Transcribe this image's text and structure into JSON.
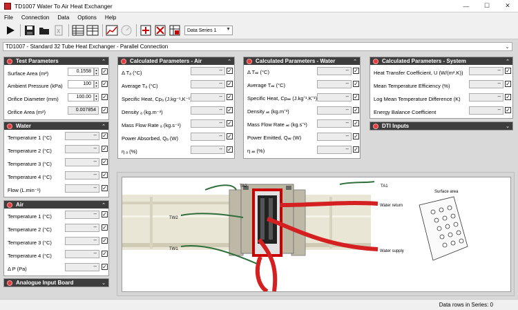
{
  "window": {
    "title": "TD1007 Water To Air Heat Exchanger"
  },
  "menu": [
    "File",
    "Connection",
    "Data",
    "Options",
    "Help"
  ],
  "toolbar": {
    "data_series": "Data Series 1"
  },
  "apparatus": {
    "selected": "TD1007 - Standard 32 Tube Heat Exchanger - Parallel Connection"
  },
  "test_params": {
    "title": "Test Parameters",
    "rows": [
      {
        "label": "Surface Area  (m²)",
        "value": "0.1558"
      },
      {
        "label": "Ambient Pressure  (kPa)",
        "value": "100"
      },
      {
        "label": "Orifice Diameter  (mm)",
        "value": "100.00"
      },
      {
        "label": "Orifice Area  (m²)",
        "value": "0.007854"
      }
    ]
  },
  "water": {
    "title": "Water",
    "rows": [
      {
        "label": "Temperature 1  (°C)",
        "value": "--"
      },
      {
        "label": "Temperature 2  (°C)",
        "value": "--"
      },
      {
        "label": "Temperature 3  (°C)",
        "value": "--"
      },
      {
        "label": "Temperature 4  (°C)",
        "value": "--"
      },
      {
        "label": "Flow  (L.min⁻¹)",
        "value": "--"
      }
    ]
  },
  "air": {
    "title": "Air",
    "rows": [
      {
        "label": "Temperature 1  (°C)",
        "value": "--"
      },
      {
        "label": "Temperature 2  (°C)",
        "value": "--"
      },
      {
        "label": "Temperature 3  (°C)",
        "value": "--"
      },
      {
        "label": "Temperature 4  (°C)",
        "value": "--"
      },
      {
        "label": "Δ P  (Pa)",
        "value": "--"
      }
    ]
  },
  "analogue": {
    "title": "Analogue Input Board"
  },
  "calc_air": {
    "title": "Calculated Parameters - Air",
    "rows": [
      {
        "label": "Δ Tₐ  (°C)",
        "value": "--"
      },
      {
        "label": "Average Tₐ  (°C)",
        "value": "--"
      },
      {
        "label": "Specific Heat, Cpₐ  (J.kg⁻¹.K⁻¹)",
        "value": "--"
      },
      {
        "label": "Density ₐ  (kg.m⁻³)",
        "value": "--"
      },
      {
        "label": "Mass Flow Rate ₐ  (kg.s⁻¹)",
        "value": "--"
      },
      {
        "label": "Power Absorbed, Qₐ  (W)",
        "value": "--"
      },
      {
        "label": "η ₐ  (%)",
        "value": "--"
      }
    ]
  },
  "calc_water": {
    "title": "Calculated Parameters - Water",
    "rows": [
      {
        "label": "Δ T𝓌  (°C)",
        "value": "--"
      },
      {
        "label": "Average T𝓌  (°C)",
        "value": "--"
      },
      {
        "label": "Specific Heat, Cp𝓌  (J.kg⁻¹.K⁻¹)",
        "value": "--"
      },
      {
        "label": "Density 𝓌  (kg.m⁻³)",
        "value": "--"
      },
      {
        "label": "Mass Flow Rate 𝓌  (kg.s⁻¹)",
        "value": "--"
      },
      {
        "label": "Power Emitted, Q𝓌  (W)",
        "value": "--"
      },
      {
        "label": "η 𝓌  (%)",
        "value": "--"
      }
    ]
  },
  "calc_system": {
    "title": "Calculated Parameters - System",
    "rows": [
      {
        "label": "Heat Transfer Coefficient, U  (W/(m².K))",
        "value": "--"
      },
      {
        "label": "Mean Temperature Efficiency  (%)",
        "value": "--"
      },
      {
        "label": "Log Mean Temperature Difference  (K)",
        "value": "--"
      },
      {
        "label": "Energy Balance Coefficient",
        "value": "--"
      }
    ]
  },
  "dti": {
    "title": "DTI Inputs"
  },
  "diagram": {
    "ta2": "TA2",
    "ta1": "TA1",
    "tw2": "TW2",
    "tw1": "TW1",
    "water_return": "Water return",
    "water_supply": "Water supply",
    "surface_area": "Surface area"
  },
  "status": {
    "text": "Data rows in Series: 0"
  }
}
